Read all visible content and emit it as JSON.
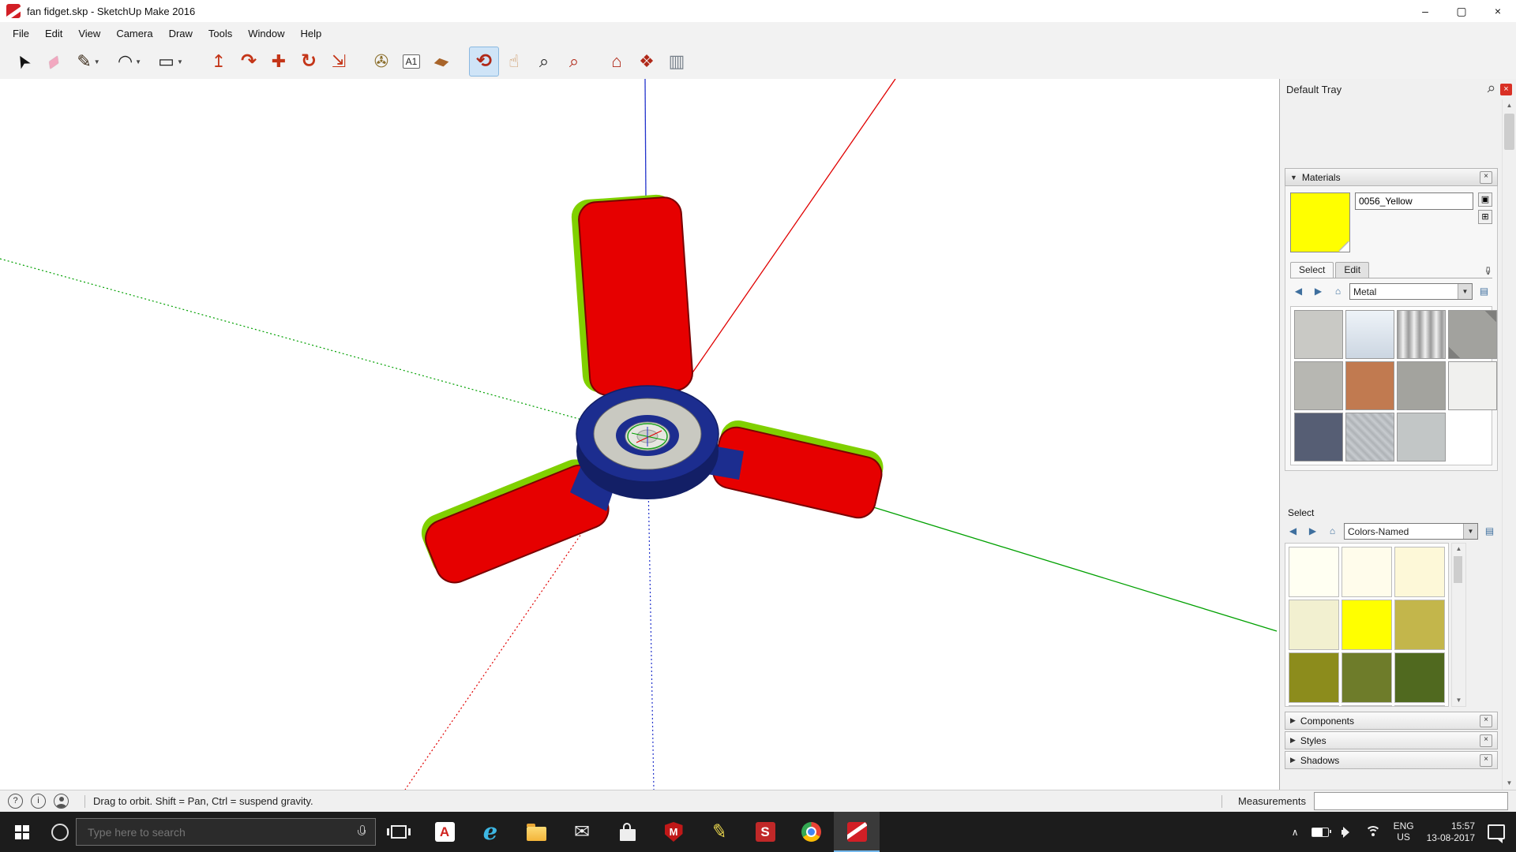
{
  "titlebar": {
    "title": "fan fidget.skp - SketchUp Make 2016",
    "minimize": "–",
    "maximize": "▢",
    "close": "×"
  },
  "menubar": {
    "items": [
      {
        "name": "menu-file",
        "label": "File"
      },
      {
        "name": "menu-edit",
        "label": "Edit"
      },
      {
        "name": "menu-view",
        "label": "View"
      },
      {
        "name": "menu-camera",
        "label": "Camera"
      },
      {
        "name": "menu-draw",
        "label": "Draw"
      },
      {
        "name": "menu-tools",
        "label": "Tools"
      },
      {
        "name": "menu-window",
        "label": "Window"
      },
      {
        "name": "menu-help",
        "label": "Help"
      }
    ]
  },
  "toolbar": {
    "tools": [
      {
        "name": "select-tool",
        "glyph": "➤",
        "color": "#111111"
      },
      {
        "name": "eraser-tool",
        "glyph": "▰",
        "color": "#f2a8c0"
      },
      {
        "name": "line-tool",
        "glyph": "✎",
        "color": "#3a2a18",
        "dropdown": true
      },
      {
        "name": "arc-tool",
        "glyph": "◠",
        "color": "#222222",
        "dropdown": true
      },
      {
        "name": "rectangle-tool",
        "glyph": "▭",
        "color": "#222222",
        "dropdown": true
      },
      {
        "name": "pushpull-tool",
        "glyph": "↥",
        "color": "#c43518",
        "gap": true
      },
      {
        "name": "followme-tool",
        "glyph": "↷",
        "color": "#c43518"
      },
      {
        "name": "move-tool",
        "glyph": "✚",
        "color": "#c43518"
      },
      {
        "name": "rotate-tool",
        "glyph": "↻",
        "color": "#c43518"
      },
      {
        "name": "scale-tool",
        "glyph": "⇲",
        "color": "#c43518"
      },
      {
        "name": "tape-measure-tool",
        "glyph": "✇",
        "color": "#8a6d2a",
        "gap": true
      },
      {
        "name": "text-tool",
        "glyph": "A1",
        "color": "#222222",
        "small": true
      },
      {
        "name": "paint-bucket-tool",
        "glyph": "▰",
        "color": "#a8642a"
      },
      {
        "name": "orbit-tool",
        "glyph": "⟲",
        "color": "#b02818",
        "gap": true,
        "selected": true
      },
      {
        "name": "pan-tool",
        "glyph": "☝",
        "color": "#c89058"
      },
      {
        "name": "zoom-tool",
        "glyph": "⌕",
        "color": "#222222"
      },
      {
        "name": "zoom-extents-tool",
        "glyph": "⌕",
        "color": "#b02818"
      },
      {
        "name": "get-models-tool",
        "glyph": "⌂",
        "color": "#b02818",
        "gap": true
      },
      {
        "name": "extension-warehouse-tool",
        "glyph": "❖",
        "color": "#b02818"
      },
      {
        "name": "send-to-layout-tool",
        "glyph": "▥",
        "color": "#77808a"
      }
    ]
  },
  "glyphs": {
    "dropdown": "▼",
    "expanded": "▼",
    "collapsed": "▶",
    "close": "×",
    "pin": "⚲",
    "back": "◀",
    "forward": "▶",
    "home": "⌂",
    "detail": "▤",
    "eyedropper": "✑",
    "secondary_pane": "▣",
    "create_material": "⊞",
    "up": "▲",
    "down": "▼",
    "chevron_up": "∧",
    "help": "?",
    "info": "i"
  },
  "canvas": {
    "colors": {
      "axis_red": "#e00000",
      "axis_green": "#00a000",
      "axis_blue": "#2233cc",
      "blade_red": "#e60000",
      "blade_edge": "#80d000",
      "blade_stroke": "#7a0000",
      "hub_navy": "#1c2d8f",
      "hub_dark": "#131f66",
      "ring_silver": "#c9c9c1",
      "center_face": "#e6e6e0",
      "selection_green": "#1fa01f"
    }
  },
  "tray": {
    "title": "Default Tray",
    "materials": {
      "header": "Materials",
      "material_name": "0056_Yellow",
      "preview_color": "#ffff00",
      "tab_select": "Select",
      "tab_edit": "Edit",
      "dropdown_value": "Metal",
      "swatches": [
        "#c9c9c5",
        "linear-gradient(180deg,#eef3f8,#ccd6e2)",
        "repeating-linear-gradient(90deg,#9a9a9a 0px,#f0f0f0 7px,#9a9a9a 14px)",
        "linear-gradient(45deg,#7e7e7c 0 12%,#a2a29e 12% 88%,#7e7e7c 88%),linear-gradient(-45deg,#7e7e7c 0 12%,#9a9a96 12% 88%,#7e7e7c 88%)",
        "#b7b7b2",
        "#c17a50",
        "#a3a39e",
        "#f0f0ee",
        "#565e74",
        "repeating-linear-gradient(45deg,#aeb2b6 0px,#c8ccd0 4px,#aeb2b6 8px)",
        "#c2c6c6"
      ]
    },
    "colors_panel": {
      "header": "Select",
      "dropdown_value": "Colors-Named",
      "swatches": [
        "#fffff2",
        "#fffceb",
        "#fdf8d8",
        "#f2f0d0",
        "#ffff00",
        "#c3b64b",
        "#8c8c1c",
        "#6e7c2a",
        "#50691f",
        "#7fc41c",
        "#8aa81e",
        "#5e7f1e"
      ]
    },
    "collapsed_panels": [
      {
        "name": "panel-components",
        "label": "Components"
      },
      {
        "name": "panel-styles",
        "label": "Styles"
      },
      {
        "name": "panel-shadows",
        "label": "Shadows"
      }
    ]
  },
  "statusbar": {
    "hint": "Drag to orbit. Shift = Pan, Ctrl = suspend gravity.",
    "measurements_label": "Measurements",
    "measurements_value": ""
  },
  "taskbar": {
    "search_placeholder": "Type here to search",
    "edge_glyph": "e",
    "adobe_glyph": "A",
    "mail_glyph": "✉",
    "mcafee_glyph": "M",
    "pencil_glyph": "✎",
    "s_glyph": "S",
    "lang": "ENG",
    "region": "US",
    "time": "15:57",
    "date": "13-08-2017"
  }
}
